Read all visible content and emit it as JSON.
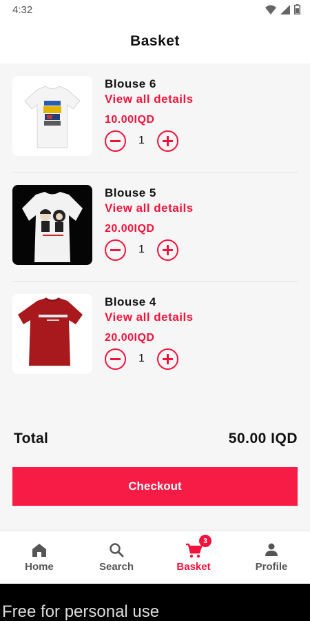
{
  "status_bar": {
    "time": "4:32"
  },
  "header": {
    "title": "Basket"
  },
  "items": [
    {
      "name": "Blouse 6",
      "details_link": "View all details",
      "price": "10.00IQD",
      "quantity": "1",
      "image": "white-tshirt-graphic"
    },
    {
      "name": "Blouse 5",
      "details_link": "View all details",
      "price": "20.00IQD",
      "quantity": "1",
      "image": "white-tshirt-characters"
    },
    {
      "name": "Blouse 4",
      "details_link": "View all details",
      "price": "20.00IQD",
      "quantity": "1",
      "image": "red-tshirt-givenchy"
    }
  ],
  "summary": {
    "total_label": "Total",
    "total_value": "50.00 IQD"
  },
  "checkout": {
    "label": "Checkout"
  },
  "nav": {
    "items": [
      {
        "label": "Home",
        "icon": "home-icon"
      },
      {
        "label": "Search",
        "icon": "search-icon"
      },
      {
        "label": "Basket",
        "icon": "cart-icon",
        "badge": "3",
        "active": true
      },
      {
        "label": "Profile",
        "icon": "person-icon"
      }
    ]
  },
  "footer": {
    "text": "Free for personal use"
  },
  "colors": {
    "accent": "#f0143c",
    "checkout": "#f71c45",
    "background": "#f6f6f6"
  }
}
